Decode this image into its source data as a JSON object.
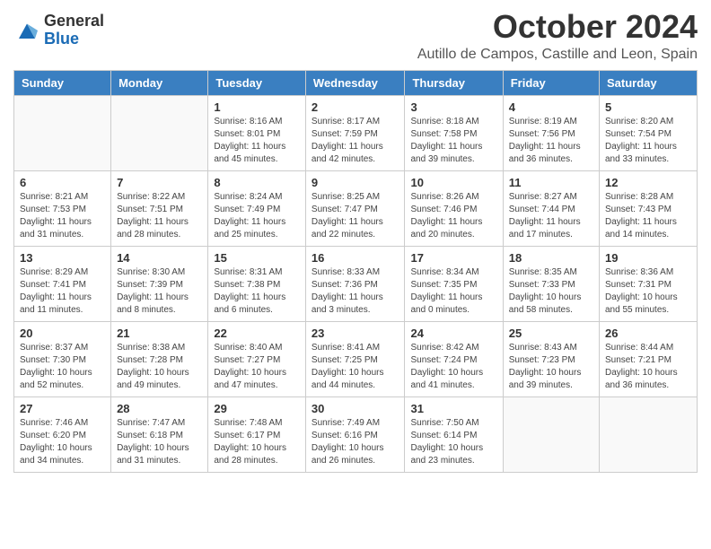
{
  "logo": {
    "general": "General",
    "blue": "Blue"
  },
  "title": "October 2024",
  "subtitle": "Autillo de Campos, Castille and Leon, Spain",
  "days_header": [
    "Sunday",
    "Monday",
    "Tuesday",
    "Wednesday",
    "Thursday",
    "Friday",
    "Saturday"
  ],
  "weeks": [
    [
      {
        "day": "",
        "info": ""
      },
      {
        "day": "",
        "info": ""
      },
      {
        "day": "1",
        "info": "Sunrise: 8:16 AM\nSunset: 8:01 PM\nDaylight: 11 hours and 45 minutes."
      },
      {
        "day": "2",
        "info": "Sunrise: 8:17 AM\nSunset: 7:59 PM\nDaylight: 11 hours and 42 minutes."
      },
      {
        "day": "3",
        "info": "Sunrise: 8:18 AM\nSunset: 7:58 PM\nDaylight: 11 hours and 39 minutes."
      },
      {
        "day": "4",
        "info": "Sunrise: 8:19 AM\nSunset: 7:56 PM\nDaylight: 11 hours and 36 minutes."
      },
      {
        "day": "5",
        "info": "Sunrise: 8:20 AM\nSunset: 7:54 PM\nDaylight: 11 hours and 33 minutes."
      }
    ],
    [
      {
        "day": "6",
        "info": "Sunrise: 8:21 AM\nSunset: 7:53 PM\nDaylight: 11 hours and 31 minutes."
      },
      {
        "day": "7",
        "info": "Sunrise: 8:22 AM\nSunset: 7:51 PM\nDaylight: 11 hours and 28 minutes."
      },
      {
        "day": "8",
        "info": "Sunrise: 8:24 AM\nSunset: 7:49 PM\nDaylight: 11 hours and 25 minutes."
      },
      {
        "day": "9",
        "info": "Sunrise: 8:25 AM\nSunset: 7:47 PM\nDaylight: 11 hours and 22 minutes."
      },
      {
        "day": "10",
        "info": "Sunrise: 8:26 AM\nSunset: 7:46 PM\nDaylight: 11 hours and 20 minutes."
      },
      {
        "day": "11",
        "info": "Sunrise: 8:27 AM\nSunset: 7:44 PM\nDaylight: 11 hours and 17 minutes."
      },
      {
        "day": "12",
        "info": "Sunrise: 8:28 AM\nSunset: 7:43 PM\nDaylight: 11 hours and 14 minutes."
      }
    ],
    [
      {
        "day": "13",
        "info": "Sunrise: 8:29 AM\nSunset: 7:41 PM\nDaylight: 11 hours and 11 minutes."
      },
      {
        "day": "14",
        "info": "Sunrise: 8:30 AM\nSunset: 7:39 PM\nDaylight: 11 hours and 8 minutes."
      },
      {
        "day": "15",
        "info": "Sunrise: 8:31 AM\nSunset: 7:38 PM\nDaylight: 11 hours and 6 minutes."
      },
      {
        "day": "16",
        "info": "Sunrise: 8:33 AM\nSunset: 7:36 PM\nDaylight: 11 hours and 3 minutes."
      },
      {
        "day": "17",
        "info": "Sunrise: 8:34 AM\nSunset: 7:35 PM\nDaylight: 11 hours and 0 minutes."
      },
      {
        "day": "18",
        "info": "Sunrise: 8:35 AM\nSunset: 7:33 PM\nDaylight: 10 hours and 58 minutes."
      },
      {
        "day": "19",
        "info": "Sunrise: 8:36 AM\nSunset: 7:31 PM\nDaylight: 10 hours and 55 minutes."
      }
    ],
    [
      {
        "day": "20",
        "info": "Sunrise: 8:37 AM\nSunset: 7:30 PM\nDaylight: 10 hours and 52 minutes."
      },
      {
        "day": "21",
        "info": "Sunrise: 8:38 AM\nSunset: 7:28 PM\nDaylight: 10 hours and 49 minutes."
      },
      {
        "day": "22",
        "info": "Sunrise: 8:40 AM\nSunset: 7:27 PM\nDaylight: 10 hours and 47 minutes."
      },
      {
        "day": "23",
        "info": "Sunrise: 8:41 AM\nSunset: 7:25 PM\nDaylight: 10 hours and 44 minutes."
      },
      {
        "day": "24",
        "info": "Sunrise: 8:42 AM\nSunset: 7:24 PM\nDaylight: 10 hours and 41 minutes."
      },
      {
        "day": "25",
        "info": "Sunrise: 8:43 AM\nSunset: 7:23 PM\nDaylight: 10 hours and 39 minutes."
      },
      {
        "day": "26",
        "info": "Sunrise: 8:44 AM\nSunset: 7:21 PM\nDaylight: 10 hours and 36 minutes."
      }
    ],
    [
      {
        "day": "27",
        "info": "Sunrise: 7:46 AM\nSunset: 6:20 PM\nDaylight: 10 hours and 34 minutes."
      },
      {
        "day": "28",
        "info": "Sunrise: 7:47 AM\nSunset: 6:18 PM\nDaylight: 10 hours and 31 minutes."
      },
      {
        "day": "29",
        "info": "Sunrise: 7:48 AM\nSunset: 6:17 PM\nDaylight: 10 hours and 28 minutes."
      },
      {
        "day": "30",
        "info": "Sunrise: 7:49 AM\nSunset: 6:16 PM\nDaylight: 10 hours and 26 minutes."
      },
      {
        "day": "31",
        "info": "Sunrise: 7:50 AM\nSunset: 6:14 PM\nDaylight: 10 hours and 23 minutes."
      },
      {
        "day": "",
        "info": ""
      },
      {
        "day": "",
        "info": ""
      }
    ]
  ]
}
